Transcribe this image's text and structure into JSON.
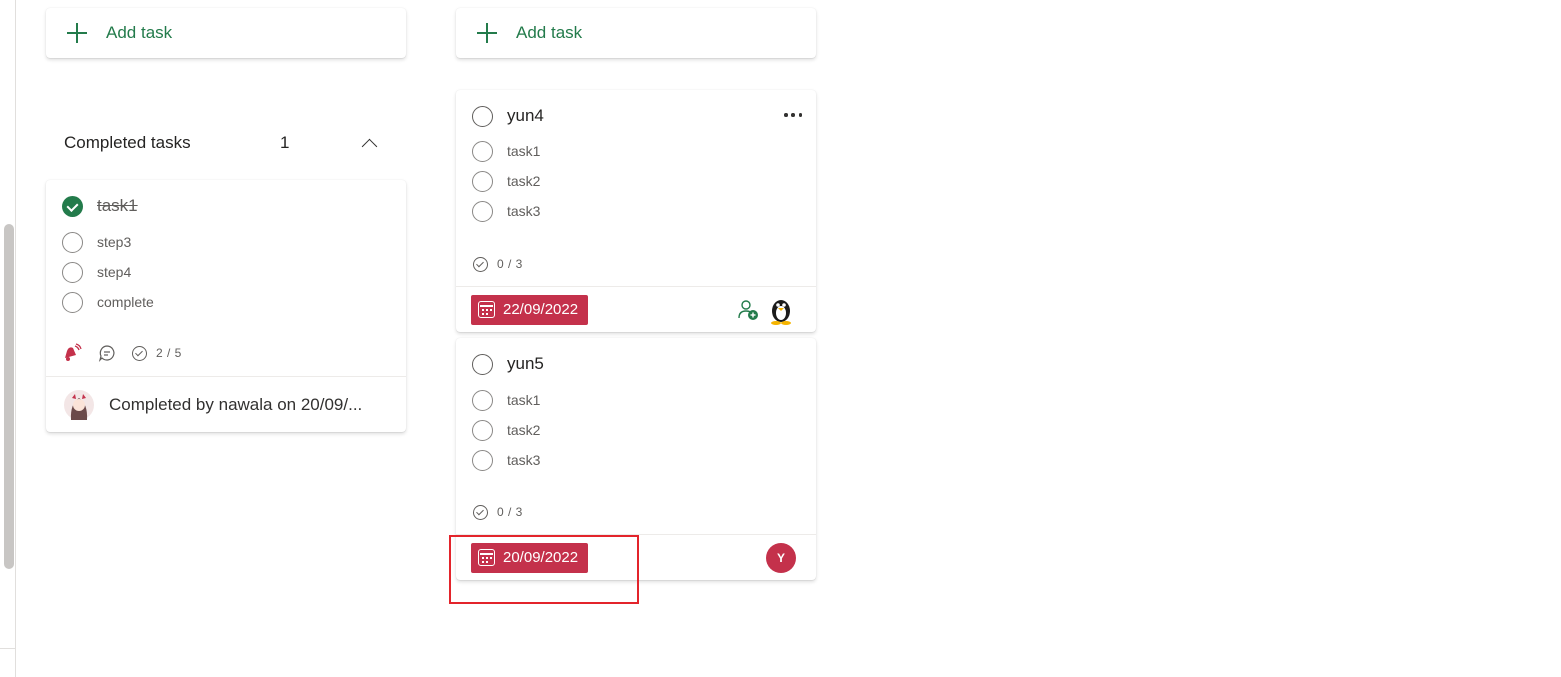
{
  "columns": [
    {
      "add_task_label": "Add task",
      "completed_section": {
        "title": "Completed tasks",
        "count": "1"
      },
      "completed_card": {
        "title": "task1",
        "checklist": [
          "step3",
          "step4",
          "complete"
        ],
        "progress": "2 / 5",
        "completed_by": "Completed by nawala on 20/09/..."
      }
    },
    {
      "add_task_label": "Add task",
      "cards": [
        {
          "title": "yun4",
          "checklist": [
            "task1",
            "task2",
            "task3"
          ],
          "progress": "0 / 3",
          "due_date": "22/09/2022"
        },
        {
          "title": "yun5",
          "checklist": [
            "task1",
            "task2",
            "task3"
          ],
          "progress": "0 / 3",
          "due_date": "20/09/2022",
          "assignee_initial": "Y"
        }
      ]
    }
  ],
  "icons": {
    "add": "plus-icon",
    "collapse": "chevron-up-icon",
    "more": "more-options-icon",
    "calendar": "calendar-icon",
    "urgent": "urgent-bell-icon",
    "comment": "comment-icon",
    "assign": "assign-person-icon"
  },
  "colors": {
    "accent_green": "#237b4b",
    "due_red": "#c4314b",
    "highlight_red": "#e3242b"
  }
}
